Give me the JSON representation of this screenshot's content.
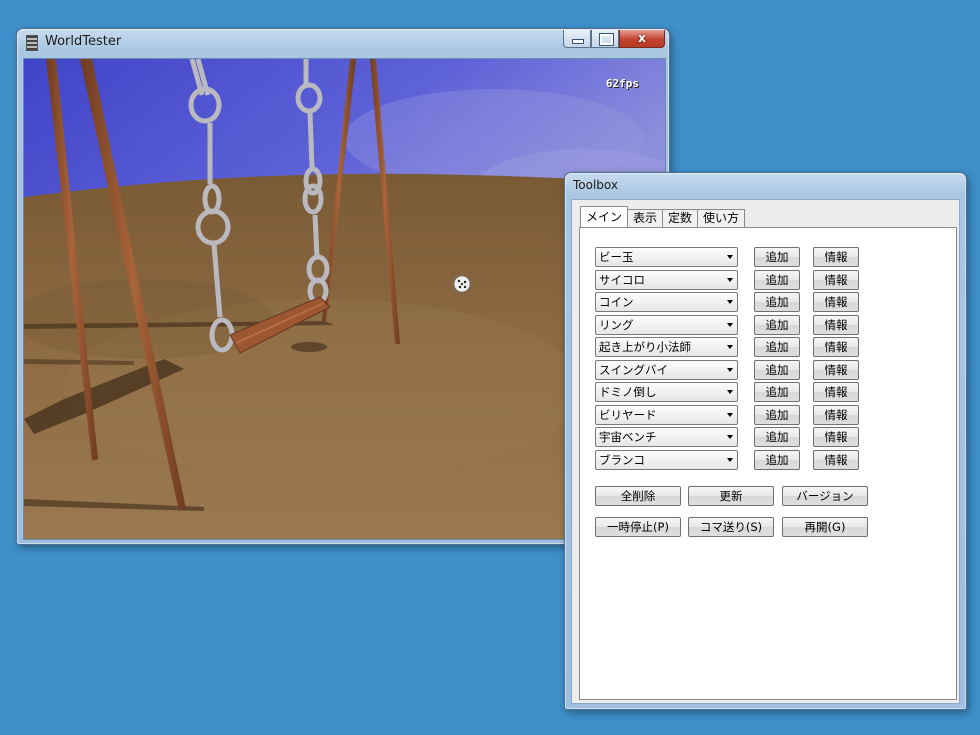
{
  "main_window": {
    "title": "WorldTester",
    "close_glyph": "x",
    "fps": "62fps"
  },
  "toolbox": {
    "title": "Toolbox",
    "tabs": [
      {
        "label": "メイン",
        "active": true
      },
      {
        "label": "表示",
        "active": false
      },
      {
        "label": "定数",
        "active": false
      },
      {
        "label": "使い方",
        "active": false
      }
    ],
    "items": [
      {
        "object": "ビー玉",
        "add": "追加",
        "info": "情報"
      },
      {
        "object": "サイコロ",
        "add": "追加",
        "info": "情報"
      },
      {
        "object": "コイン",
        "add": "追加",
        "info": "情報"
      },
      {
        "object": "リング",
        "add": "追加",
        "info": "情報"
      },
      {
        "object": "起き上がり小法師",
        "add": "追加",
        "info": "情報"
      },
      {
        "object": "スイングバイ",
        "add": "追加",
        "info": "情報"
      },
      {
        "object": "ドミノ倒し",
        "add": "追加",
        "info": "情報"
      },
      {
        "object": "ビリヤード",
        "add": "追加",
        "info": "情報"
      },
      {
        "object": "宇宙ベンチ",
        "add": "追加",
        "info": "情報"
      },
      {
        "object": "ブランコ",
        "add": "追加",
        "info": "情報"
      }
    ],
    "buttons_row1": [
      "全削除",
      "更新",
      "バージョン"
    ],
    "buttons_row2": [
      "一時停止(P)",
      "コマ送り(S)",
      "再開(G)"
    ]
  },
  "colors": {
    "desktop": "#3f8fca",
    "sky": "#5b5ed4",
    "ground": "#8a6a44",
    "swing_frame": "#8a4a2a",
    "chain": "#c8c8cc"
  },
  "icons": [
    "app-icon",
    "minimize-icon",
    "maximize-icon",
    "close-icon",
    "dropdown-arrow-icon"
  ]
}
